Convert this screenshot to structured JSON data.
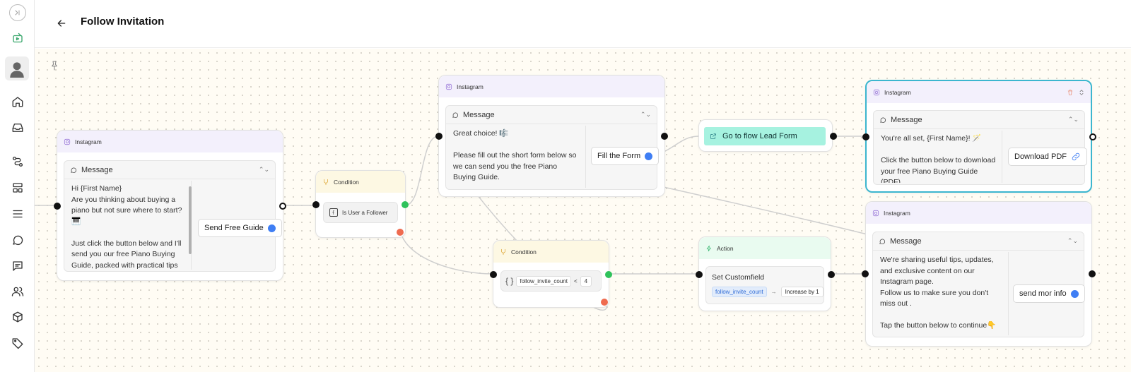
{
  "header": {
    "title": "Follow Invitation"
  },
  "sidebar": {
    "items": [
      {
        "icon": "home-icon"
      },
      {
        "icon": "inbox-icon"
      },
      {
        "icon": "flow-icon"
      },
      {
        "icon": "layout-icon"
      },
      {
        "icon": "list-icon"
      },
      {
        "icon": "chat-icon"
      },
      {
        "icon": "message-square-icon"
      },
      {
        "icon": "users-icon"
      },
      {
        "icon": "package-icon"
      },
      {
        "icon": "tag-icon"
      }
    ]
  },
  "nodes": {
    "ig1": {
      "channel": "Instagram",
      "message_label": "Message",
      "text": "Hi {First Name}\nAre you thinking about buying a piano but not sure where to start? 🎹\n\nJust click the button below and I'll send you our free Piano Buying Guide, packed with practical tips to",
      "button": "Send Free Guide"
    },
    "cond1": {
      "type": "Condition",
      "rule": "Is User a Follower"
    },
    "ig2": {
      "channel": "Instagram",
      "message_label": "Message",
      "text": "Great choice! 🎼\n\nPlease fill out the short form below so we can send you the free Piano Buying Guide.",
      "button": "Fill the Form"
    },
    "goto": {
      "label": "Go to flow Lead Form"
    },
    "ig3": {
      "channel": "Instagram",
      "message_label": "Message",
      "text": "You're all set, {First Name}! 🪄\n\nClick the button below to download your free Piano Buying Guide (PDF).",
      "button": "Download PDF"
    },
    "cond2": {
      "type": "Condition",
      "field": "follow_invite_count",
      "operator": "<",
      "value": "4"
    },
    "action": {
      "type": "Action",
      "label": "Set Customfield",
      "field": "follow_invite_count",
      "operation": "Increase by 1"
    },
    "ig4": {
      "channel": "Instagram",
      "message_label": "Message",
      "text": "We're sharing useful tips, updates, and exclusive content on our Instagram page.\nFollow us to make sure you don't miss out .\n\nTap the button below to continue👇",
      "button": "send mor info"
    }
  },
  "colors": {
    "selected_border": "#3cb6cf",
    "instagram_header": "#f3f0fc",
    "condition_header": "#fdf8e3",
    "action_header": "#e9fbf0",
    "button_port": "#3f7ef4",
    "true_port": "#2fc25b",
    "false_port": "#ef6b4f",
    "goto_fill": "#a6f2e0"
  }
}
